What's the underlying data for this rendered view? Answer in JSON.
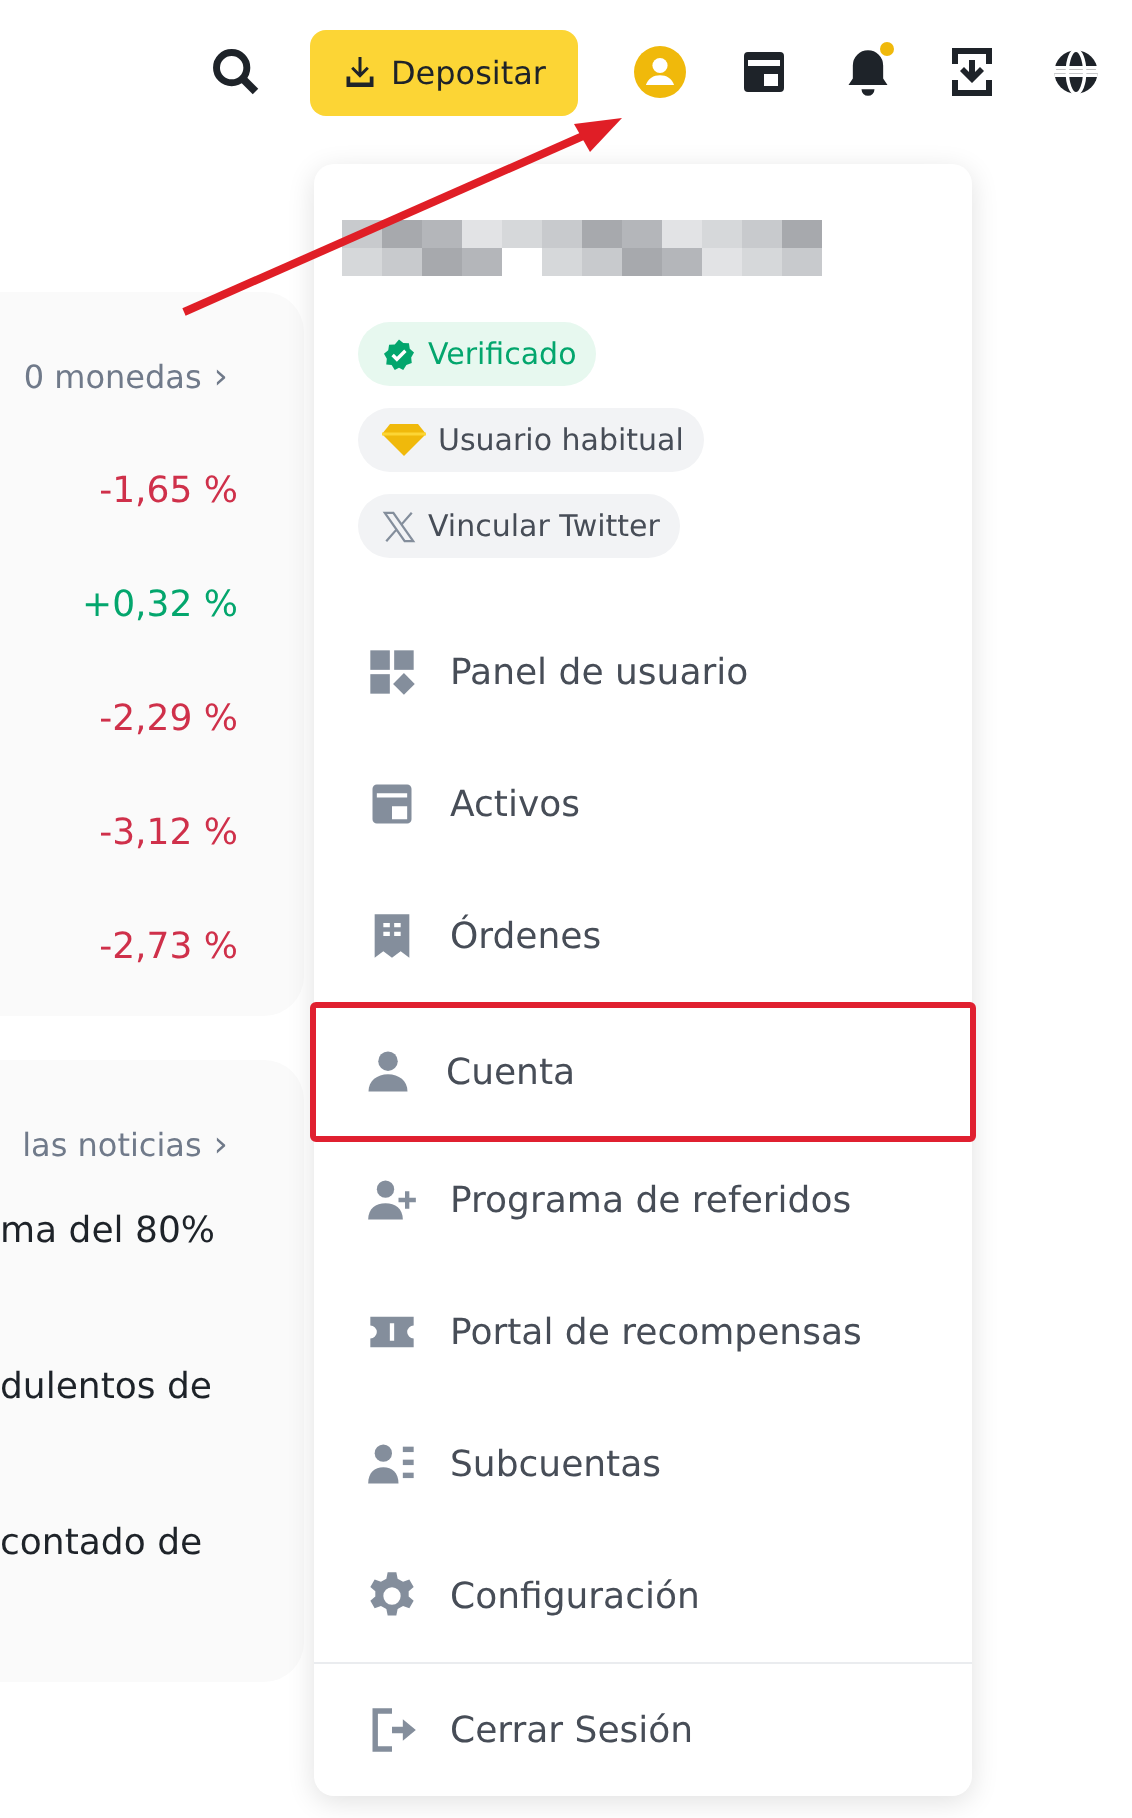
{
  "top_bar": {
    "deposit_button": "Depositar",
    "notification_dot": true
  },
  "market_card": {
    "link": "0 monedas",
    "link_arrow": "›",
    "changes": [
      {
        "value": "-1,65 %",
        "color": "#cf304a"
      },
      {
        "value": "+0,32 %",
        "color": "#03a66d"
      },
      {
        "value": "-2,29 %",
        "color": "#cf304a"
      },
      {
        "value": "-3,12 %",
        "color": "#cf304a"
      },
      {
        "value": "-2,73 %",
        "color": "#cf304a"
      }
    ]
  },
  "news_card": {
    "link": "las noticias",
    "link_arrow": "›",
    "lines": [
      "ma del 80%",
      "dulentos de",
      "contado de"
    ]
  },
  "account_menu": {
    "badges": [
      {
        "label": "Verificado",
        "kind": "verified"
      },
      {
        "label": "Usuario habitual",
        "kind": "tier"
      },
      {
        "label": "Vincular Twitter",
        "kind": "social"
      }
    ],
    "items": [
      {
        "label": "Panel de usuario",
        "highlighted": false
      },
      {
        "label": "Activos",
        "highlighted": false
      },
      {
        "label": "Órdenes",
        "highlighted": false
      },
      {
        "label": "Cuenta",
        "highlighted": true
      },
      {
        "label": "Programa de referidos",
        "highlighted": false
      },
      {
        "label": "Portal de recompensas",
        "highlighted": false
      },
      {
        "label": "Subcuentas",
        "highlighted": false
      },
      {
        "label": "Configuración",
        "highlighted": false
      }
    ],
    "logout": "Cerrar Sesión"
  }
}
